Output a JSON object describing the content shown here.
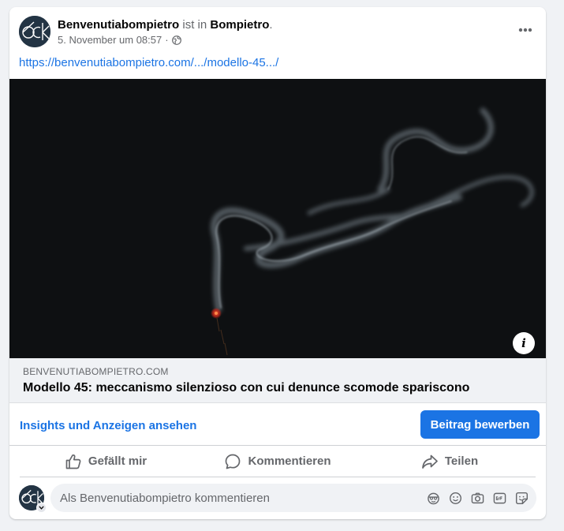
{
  "post": {
    "author_name": "Benvenutiabompietro",
    "status_word": "ist in",
    "place_name": "Bompietro",
    "place_suffix": ".",
    "timestamp": "5. November um 08:57",
    "separator": "·",
    "link_text": "https://benvenutiabompietro.com/.../modello-45.../",
    "avatar_icon": "bck-logo-icon",
    "privacy_icon": "globe-icon"
  },
  "media": {
    "info_label": "i",
    "background_color": "#0b0d0e"
  },
  "link_preview": {
    "domain": "BENVENUTIABOMPIETRO.COM",
    "title": "Modello 45: meccanismo silenzioso con cui denunce scomode spariscono"
  },
  "promo": {
    "insights_label": "Insights und Anzeigen ansehen",
    "boost_label": "Beitrag bewerben"
  },
  "actions": {
    "like_label": "Gefällt mir",
    "comment_label": "Kommentieren",
    "share_label": "Teilen"
  },
  "comment": {
    "placeholder": "Als Benvenutiabompietro kommentieren",
    "tools": [
      "avatar-sticker-icon",
      "emoji-icon",
      "camera-icon",
      "gif-icon",
      "sticker-icon"
    ]
  },
  "colors": {
    "accent": "#1b74e4",
    "muted_text": "#65676b",
    "page_background": "#f0f2f5",
    "avatar_background": "#233444"
  }
}
